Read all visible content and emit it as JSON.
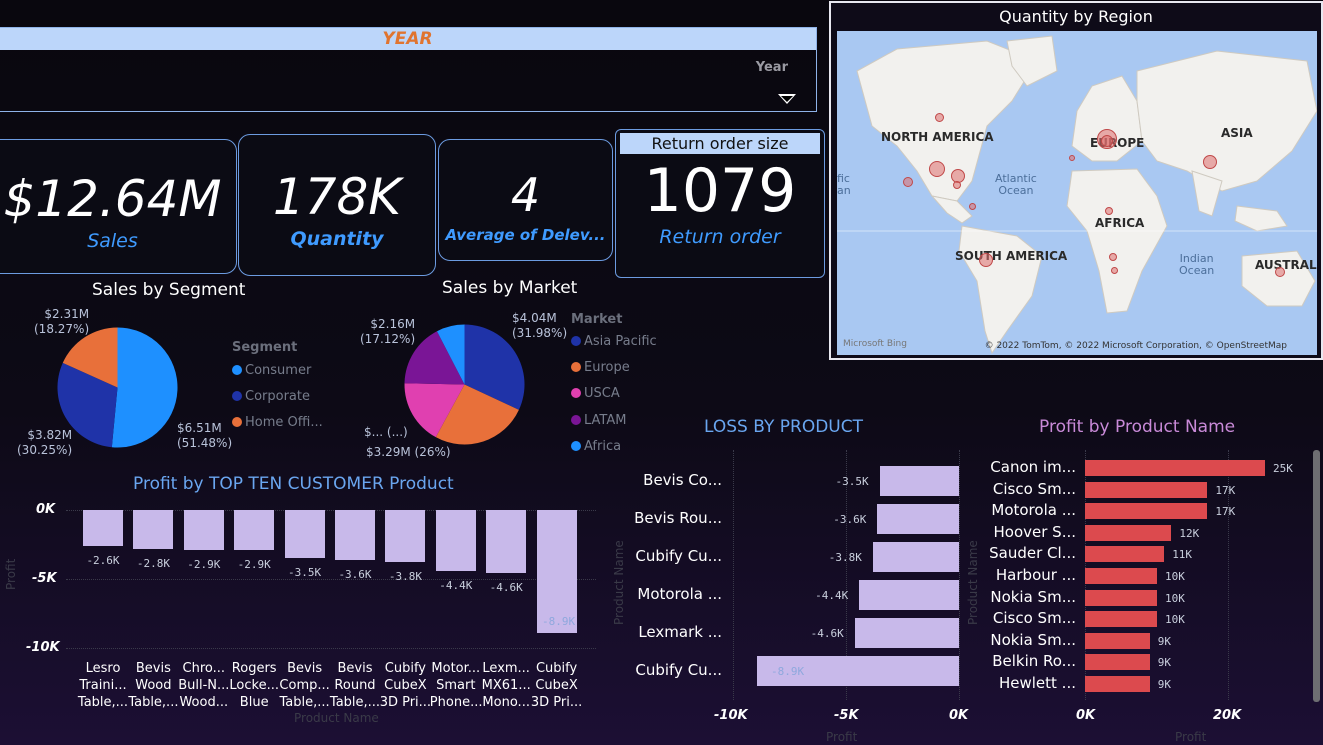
{
  "slicer": {
    "title": "YEAR",
    "field": "Year"
  },
  "kpis": [
    {
      "value": "$12.64M",
      "label": "Sales"
    },
    {
      "value": "178K",
      "label": "Quantity"
    },
    {
      "value": "4",
      "label": "Average of Delev..."
    },
    {
      "header": "Return order size",
      "value": "1079",
      "label": "Return order"
    }
  ],
  "map": {
    "title": "Quantity by Region",
    "regions": [
      "NORTH AMERICA",
      "EUROPE",
      "ASIA",
      "AFRICA",
      "SOUTH AMERICA",
      "AUSTRALIA"
    ],
    "oceans": [
      "Atlantic\nOcean",
      "Indian\nOcean",
      "fic\nan"
    ],
    "credit": "© 2022 TomTom, © 2022 Microsoft Corporation, © OpenStreetMap",
    "logo": "Microsoft Bing"
  },
  "segment": {
    "title": "Sales by Segment",
    "legend_title": "Segment",
    "legend": [
      "Consumer",
      "Corporate",
      "Home Offi..."
    ],
    "labels": [
      "$2.31M\n(18.27%)",
      "$3.82M\n(30.25%)",
      "$6.51M\n(51.48%)"
    ],
    "colors": {
      "Consumer": "#1e90ff",
      "Corporate": "#1f33a8",
      "Home Office": "#e8703a"
    }
  },
  "market": {
    "title": "Sales by Market",
    "legend_title": "Market",
    "legend": [
      "Asia Pacific",
      "Europe",
      "USCA",
      "LATAM",
      "Africa"
    ],
    "labels": [
      "$2.16M\n(17.12%)",
      "$4.04M\n(31.98%)",
      "$... (...)",
      "$3.29M (26%)"
    ],
    "colors": [
      "#1f33a8",
      "#e8703a",
      "#e040b0",
      "#7a1596",
      "#1e90ff"
    ]
  },
  "top_customer": {
    "title": "Profit by TOP TEN CUSTOMER Product",
    "y_ticks": [
      "0K",
      "-5K",
      "-10K"
    ],
    "y_label": "Profit",
    "x_label": "Product Name",
    "categories": [
      "Lesro\nTraini...\nTable,...",
      "Bevis\nWood\nTable,...",
      "Chro...\nBull-N...\nWood...",
      "Rogers\nLocke...\nBlue",
      "Bevis\nComp...\nTable,...",
      "Bevis\nRound\nTable,...",
      "Cubify\nCubeX\n3D Pri...",
      "Motor...\nSmart\nPhone...",
      "Lexm...\nMX61...\nMono...",
      "Cubify\nCubeX\n3D Pri..."
    ],
    "labels": [
      "-2.6K",
      "-2.8K",
      "-2.9K",
      "-2.9K",
      "-3.5K",
      "-3.6K",
      "-3.8K",
      "-4.4K",
      "-4.6K",
      "-8.9K"
    ]
  },
  "loss": {
    "title": "LOSS BY PRODUCT",
    "categories": [
      "Bevis Co...",
      "Bevis Rou...",
      "Cubify Cu...",
      "Motorola ...",
      "Lexmark ...",
      "Cubify Cu..."
    ],
    "labels": [
      "-3.5K",
      "-3.6K",
      "-3.8K",
      "-4.4K",
      "-4.6K",
      "-8.9K"
    ],
    "x_ticks": [
      "-10K",
      "-5K",
      "0K"
    ],
    "x_label": "Profit",
    "y_label": "Product Name"
  },
  "profit": {
    "title": "Profit by Product Name",
    "categories": [
      "Canon im...",
      "Cisco Sm...",
      "Motorola ...",
      "Hoover S...",
      "Sauder Cl...",
      "Harbour ...",
      "Nokia Sm...",
      "Cisco Sm...",
      "Nokia Sm...",
      "Belkin Ro...",
      "Hewlett ..."
    ],
    "labels": [
      "25K",
      "17K",
      "17K",
      "12K",
      "11K",
      "10K",
      "10K",
      "10K",
      "9K",
      "9K",
      "9K"
    ],
    "x_ticks": [
      "0K",
      "20K"
    ],
    "x_label": "Profit",
    "y_label": "Product Name"
  },
  "chart_data": [
    {
      "type": "pie",
      "title": "Sales by Segment",
      "categories": [
        "Consumer",
        "Corporate",
        "Home Office"
      ],
      "values": [
        6.51,
        3.82,
        2.31
      ],
      "unit": "$M",
      "percent": [
        51.48,
        30.25,
        18.27
      ]
    },
    {
      "type": "pie",
      "title": "Sales by Market",
      "categories": [
        "Asia Pacific",
        "Europe",
        "USCA",
        "LATAM",
        "Africa"
      ],
      "values": [
        4.04,
        3.29,
        2.2,
        2.16,
        0.96
      ],
      "unit": "$M"
    },
    {
      "type": "bar",
      "title": "Profit by TOP TEN CUSTOMER Product",
      "values": [
        -2.6,
        -2.8,
        -2.9,
        -2.9,
        -3.5,
        -3.6,
        -3.8,
        -4.4,
        -4.6,
        -8.9
      ],
      "ylim": [
        -10,
        0
      ],
      "unit": "K"
    },
    {
      "type": "bar",
      "title": "LOSS BY PRODUCT",
      "orientation": "horizontal",
      "values": [
        -3.5,
        -3.6,
        -3.8,
        -4.4,
        -4.6,
        -8.9
      ],
      "xlim": [
        -10,
        0
      ],
      "unit": "K"
    },
    {
      "type": "bar",
      "title": "Profit by Product Name",
      "orientation": "horizontal",
      "values": [
        25,
        17,
        17,
        12,
        11,
        10,
        10,
        10,
        9,
        9,
        9
      ],
      "xlim": [
        0,
        22
      ],
      "unit": "K"
    }
  ]
}
